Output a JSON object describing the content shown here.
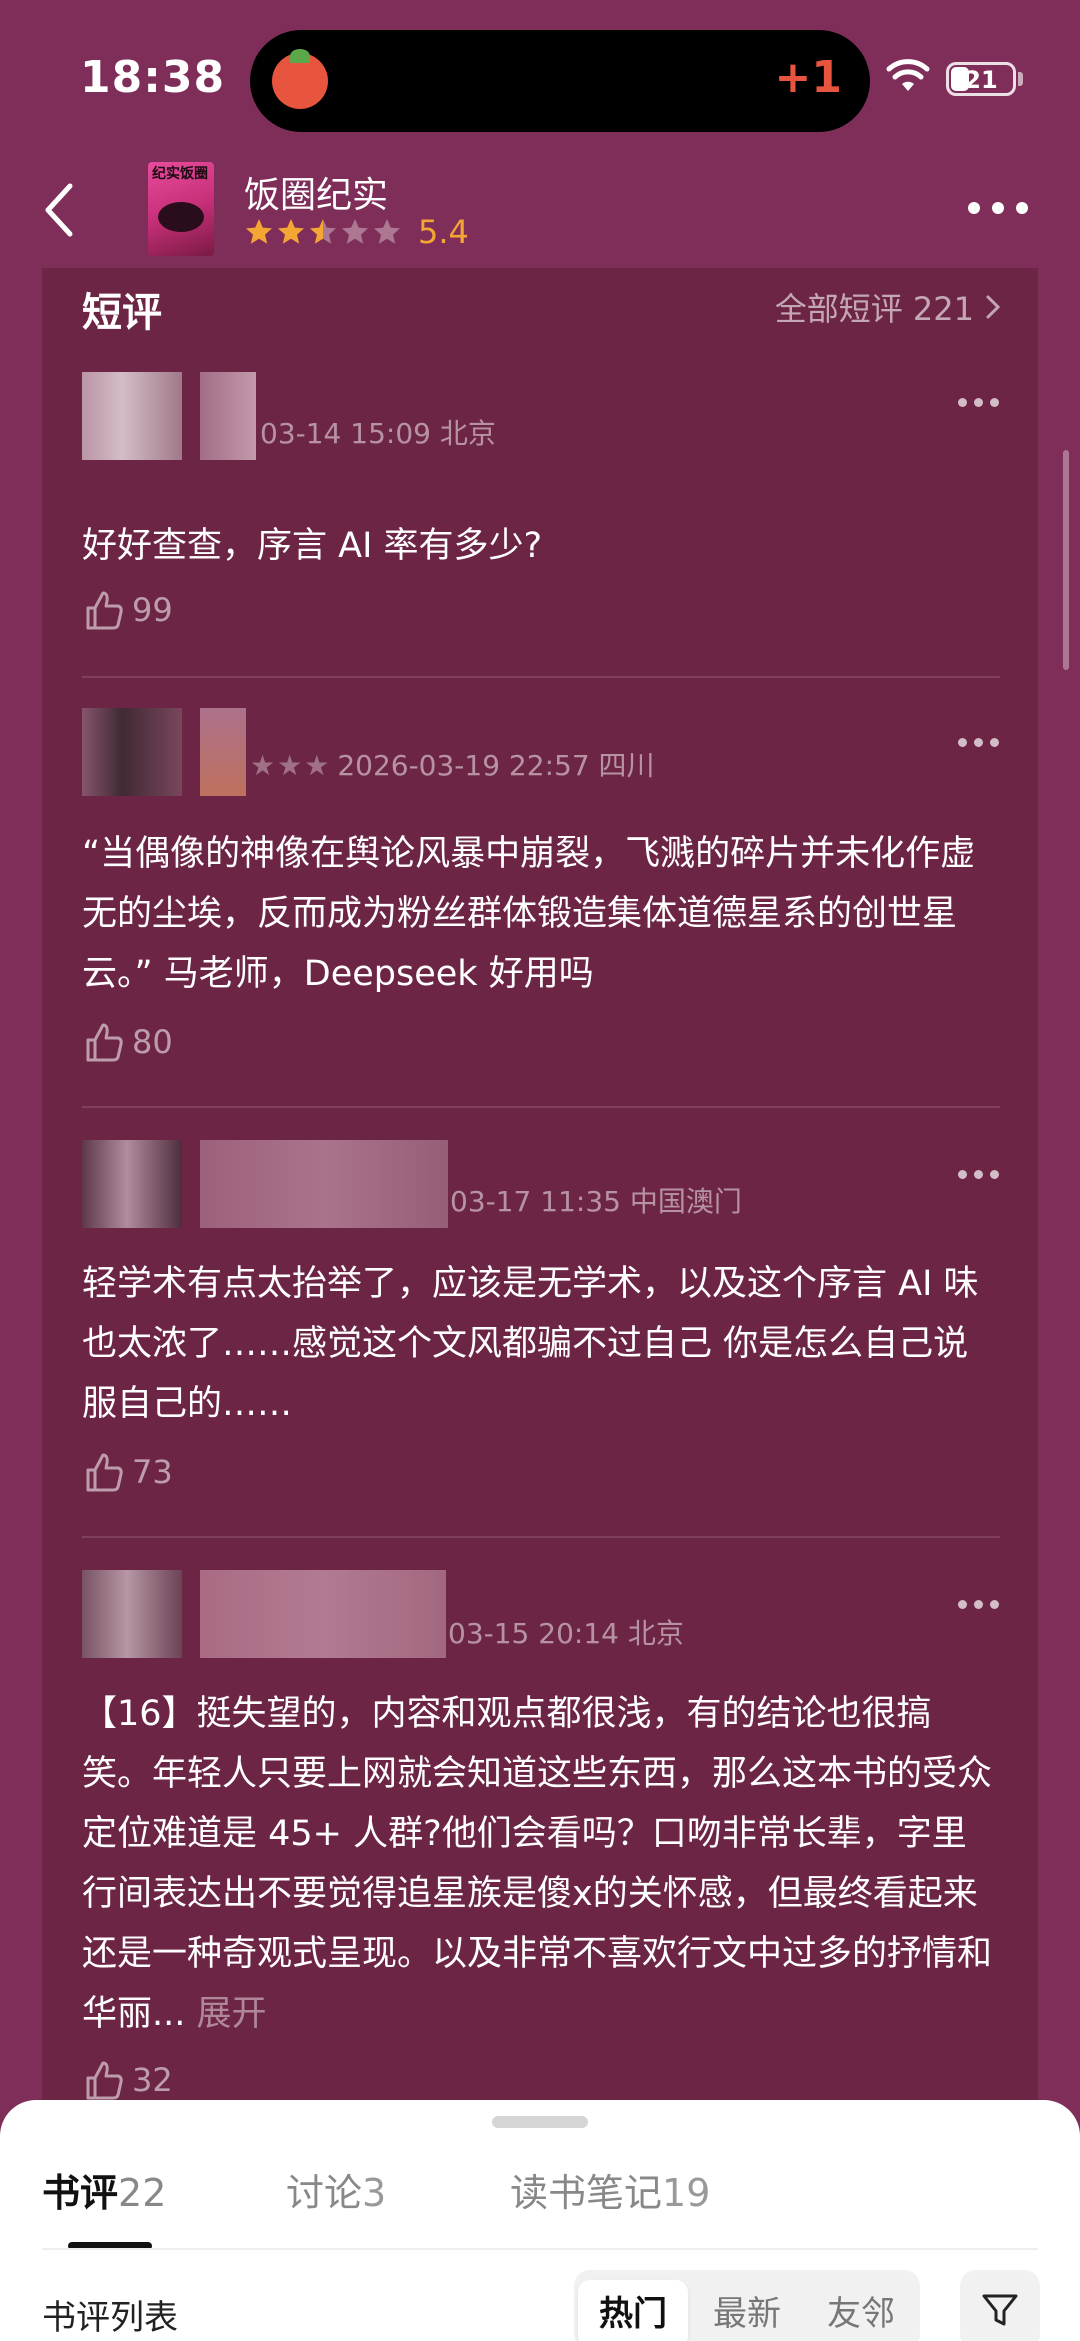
{
  "status_bar": {
    "time": "18:38",
    "island_badge": "+1",
    "battery": "21",
    "icons": [
      "tomato-app-icon",
      "wifi-icon",
      "battery-icon"
    ]
  },
  "nav": {
    "back_icon": "back-chevron-icon",
    "book_title": "饭圈纪实",
    "cover_text": "纪实饭圈",
    "rating": "5.4",
    "stars_filled": 2.5,
    "stars_total": 5,
    "more_icon": "more-dots-icon"
  },
  "reviews_section": {
    "title": "短评",
    "all_label": "全部短评 221",
    "items": [
      {
        "meta": "03-14 15:09 北京",
        "meta_stars": "",
        "text": "好好查查，序言 AI 率有多少?",
        "likes": "99"
      },
      {
        "meta": "2026-03-19 22:57 四川",
        "meta_stars": "★★★",
        "text": "“当偶像的神像在舆论风暴中崩裂，飞溅的碎片并未化作虚无的尘埃，反而成为粉丝群体锻造集体道德星系的创世星云。” 马老师，Deepseek 好用吗",
        "likes": "80"
      },
      {
        "meta": "03-17 11:35 中国澳门",
        "meta_stars": "",
        "text": "轻学术有点太抬举了，应该是无学术，以及这个序言 AI 味也太浓了……感觉这个文风都骗不过自己 你是怎么自己说服自己的……",
        "likes": "73"
      },
      {
        "meta": "03-15 20:14 北京",
        "meta_stars": "",
        "text": "【16】挺失望的，内容和观点都很浅，有的结论也很搞笑。年轻人只要上网就会知道这些东西，那么这本书的受众定位难道是 45+ 人群?他们会看吗？口吻非常长辈，字里行间表达出不要觉得追星族是傻x的关怀感，但最终看起来还是一种奇观式呈现。以及非常不喜欢行文中过多的抒情和华丽...",
        "expand": "展开",
        "likes": "32"
      }
    ]
  },
  "sheet": {
    "tabs": [
      {
        "label": "书评",
        "count": "22"
      },
      {
        "label": "讨论",
        "count": "3"
      },
      {
        "label": "读书笔记",
        "count": "19"
      }
    ],
    "list_label": "书评列表",
    "sort_options": [
      "热门",
      "最新",
      "友邻"
    ],
    "filter_icon": "filter-icon"
  }
}
